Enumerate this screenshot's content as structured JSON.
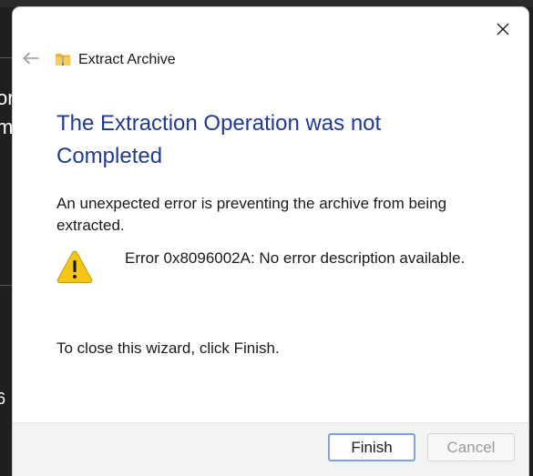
{
  "background": {
    "fragment_1": "ori",
    "fragment_2": "m",
    "fragment_3": "6"
  },
  "dialog": {
    "window_title": "Extract Archive",
    "heading": "The Extraction Operation was not Completed",
    "description": "An unexpected error is preventing the archive from being extracted.",
    "error_message": "Error 0x8096002A: No error description available.",
    "instruction": "To close this wizard, click Finish.",
    "icons": {
      "close": "close-icon",
      "back": "back-arrow-icon",
      "folder": "zip-folder-icon",
      "warning": "warning-icon"
    },
    "buttons": {
      "finish": "Finish",
      "cancel": "Cancel"
    },
    "colors": {
      "heading": "#1f3a93",
      "warning_fill": "#f5c518",
      "finish_border": "#7aa3d9"
    }
  }
}
